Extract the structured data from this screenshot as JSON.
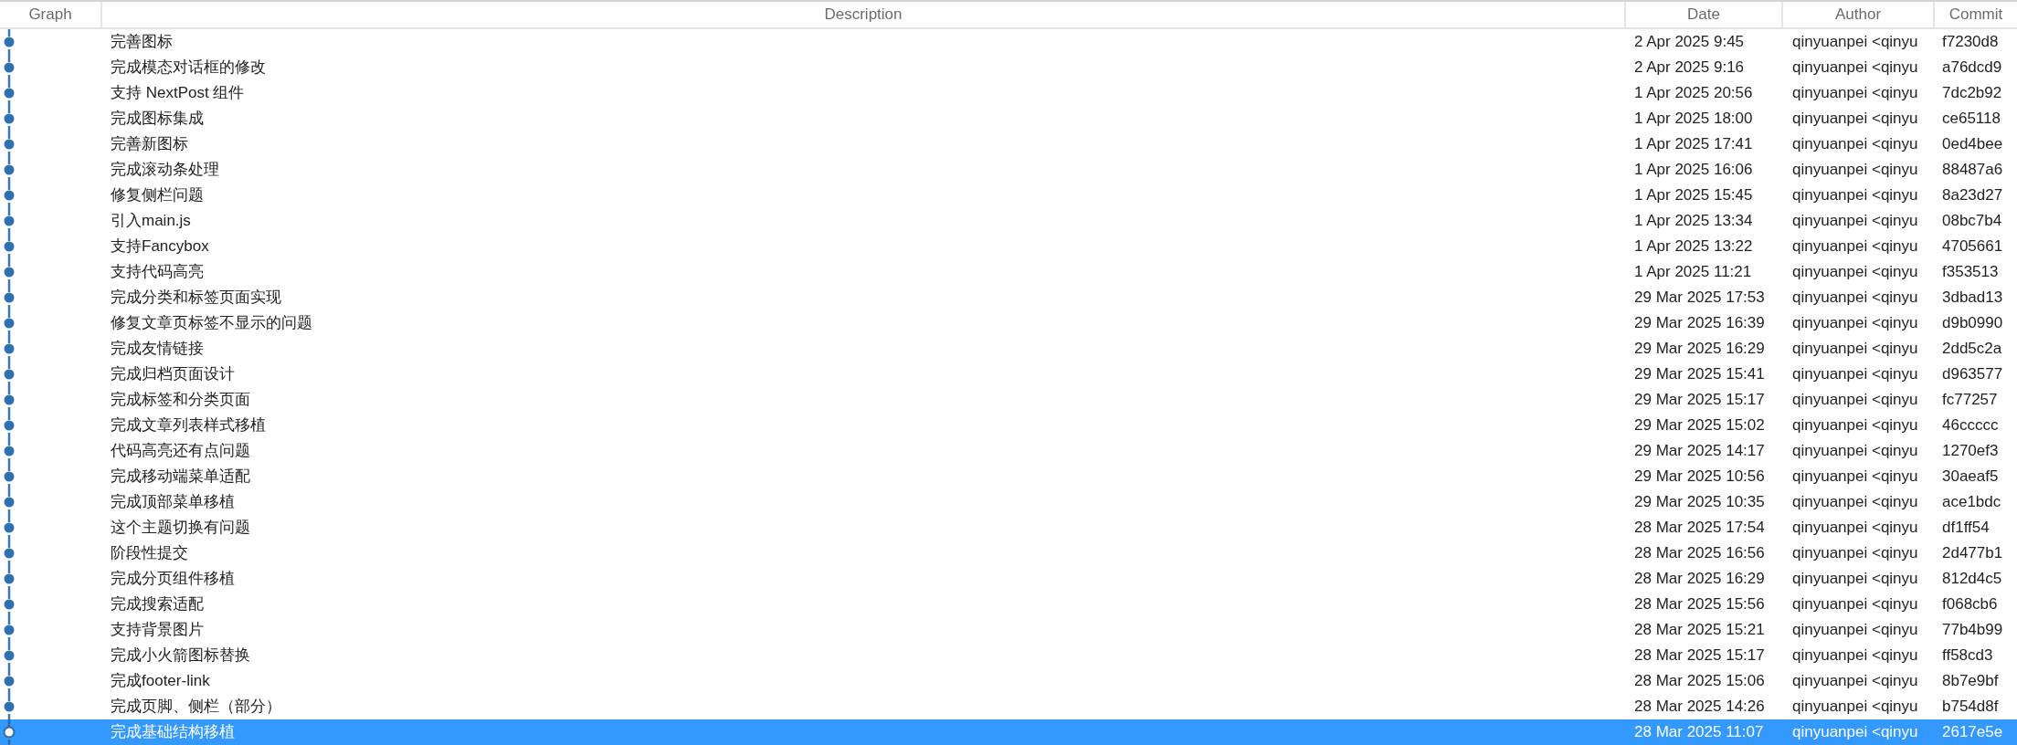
{
  "columns": [
    "Graph",
    "Description",
    "Date",
    "Author",
    "Commit"
  ],
  "rows": [
    {
      "description": "完善图标",
      "date": "2 Apr 2025 9:45",
      "author": "qinyuanpei <qinyu",
      "commit": "f7230d8",
      "selected": false
    },
    {
      "description": "完成模态对话框的修改",
      "date": "2 Apr 2025 9:16",
      "author": "qinyuanpei <qinyu",
      "commit": "a76dcd9",
      "selected": false
    },
    {
      "description": "支持 NextPost 组件",
      "date": "1 Apr 2025 20:56",
      "author": "qinyuanpei <qinyu",
      "commit": "7dc2b92",
      "selected": false
    },
    {
      "description": "完成图标集成",
      "date": "1 Apr 2025 18:00",
      "author": "qinyuanpei <qinyu",
      "commit": "ce65118",
      "selected": false
    },
    {
      "description": "完善新图标",
      "date": "1 Apr 2025 17:41",
      "author": "qinyuanpei <qinyu",
      "commit": "0ed4bee",
      "selected": false
    },
    {
      "description": "完成滚动条处理",
      "date": "1 Apr 2025 16:06",
      "author": "qinyuanpei <qinyu",
      "commit": "88487a6",
      "selected": false
    },
    {
      "description": "修复侧栏问题",
      "date": "1 Apr 2025 15:45",
      "author": "qinyuanpei <qinyu",
      "commit": "8a23d27",
      "selected": false
    },
    {
      "description": "引入main.js",
      "date": "1 Apr 2025 13:34",
      "author": "qinyuanpei <qinyu",
      "commit": "08bc7b4",
      "selected": false
    },
    {
      "description": "支持Fancybox",
      "date": "1 Apr 2025 13:22",
      "author": "qinyuanpei <qinyu",
      "commit": "4705661",
      "selected": false
    },
    {
      "description": "支持代码高亮",
      "date": "1 Apr 2025 11:21",
      "author": "qinyuanpei <qinyu",
      "commit": "f353513",
      "selected": false
    },
    {
      "description": "完成分类和标签页面实现",
      "date": "29 Mar 2025 17:53",
      "author": "qinyuanpei <qinyu",
      "commit": "3dbad13",
      "selected": false
    },
    {
      "description": "修复文章页标签不显示的问题",
      "date": "29 Mar 2025 16:39",
      "author": "qinyuanpei <qinyu",
      "commit": "d9b0990",
      "selected": false
    },
    {
      "description": "完成友情链接",
      "date": "29 Mar 2025 16:29",
      "author": "qinyuanpei <qinyu",
      "commit": "2dd5c2a",
      "selected": false
    },
    {
      "description": "完成归档页面设计",
      "date": "29 Mar 2025 15:41",
      "author": "qinyuanpei <qinyu",
      "commit": "d963577",
      "selected": false
    },
    {
      "description": "完成标签和分类页面",
      "date": "29 Mar 2025 15:17",
      "author": "qinyuanpei <qinyu",
      "commit": "fc77257",
      "selected": false
    },
    {
      "description": "完成文章列表样式移植",
      "date": "29 Mar 2025 15:02",
      "author": "qinyuanpei <qinyu",
      "commit": "46ccccc",
      "selected": false
    },
    {
      "description": "代码高亮还有点问题",
      "date": "29 Mar 2025 14:17",
      "author": "qinyuanpei <qinyu",
      "commit": "1270ef3",
      "selected": false
    },
    {
      "description": "完成移动端菜单适配",
      "date": "29 Mar 2025 10:56",
      "author": "qinyuanpei <qinyu",
      "commit": "30aeaf5",
      "selected": false
    },
    {
      "description": "完成顶部菜单移植",
      "date": "29 Mar 2025 10:35",
      "author": "qinyuanpei <qinyu",
      "commit": "ace1bdc",
      "selected": false
    },
    {
      "description": "这个主题切换有问题",
      "date": "28 Mar 2025 17:54",
      "author": "qinyuanpei <qinyu",
      "commit": "df1ff54",
      "selected": false
    },
    {
      "description": "阶段性提交",
      "date": "28 Mar 2025 16:56",
      "author": "qinyuanpei <qinyu",
      "commit": "2d477b1",
      "selected": false
    },
    {
      "description": "完成分页组件移植",
      "date": "28 Mar 2025 16:29",
      "author": "qinyuanpei <qinyu",
      "commit": "812d4c5",
      "selected": false
    },
    {
      "description": "完成搜索适配",
      "date": "28 Mar 2025 15:56",
      "author": "qinyuanpei <qinyu",
      "commit": "f068cb6",
      "selected": false
    },
    {
      "description": "支持背景图片",
      "date": "28 Mar 2025 15:21",
      "author": "qinyuanpei <qinyu",
      "commit": "77b4b99",
      "selected": false
    },
    {
      "description": "完成小火箭图标替换",
      "date": "28 Mar 2025 15:17",
      "author": "qinyuanpei <qinyu",
      "commit": "ff58cd3",
      "selected": false
    },
    {
      "description": "完成footer-link",
      "date": "28 Mar 2025 15:06",
      "author": "qinyuanpei <qinyu",
      "commit": "8b7e9bf",
      "selected": false
    },
    {
      "description": "完成页脚、侧栏（部分）",
      "date": "28 Mar 2025 14:26",
      "author": "qinyuanpei <qinyu",
      "commit": "b754d8f",
      "selected": false
    },
    {
      "description": "完成基础结构移植",
      "date": "28 Mar 2025 11:07",
      "author": "qinyuanpei <qinyu",
      "commit": "2617e5e",
      "selected": true
    }
  ]
}
